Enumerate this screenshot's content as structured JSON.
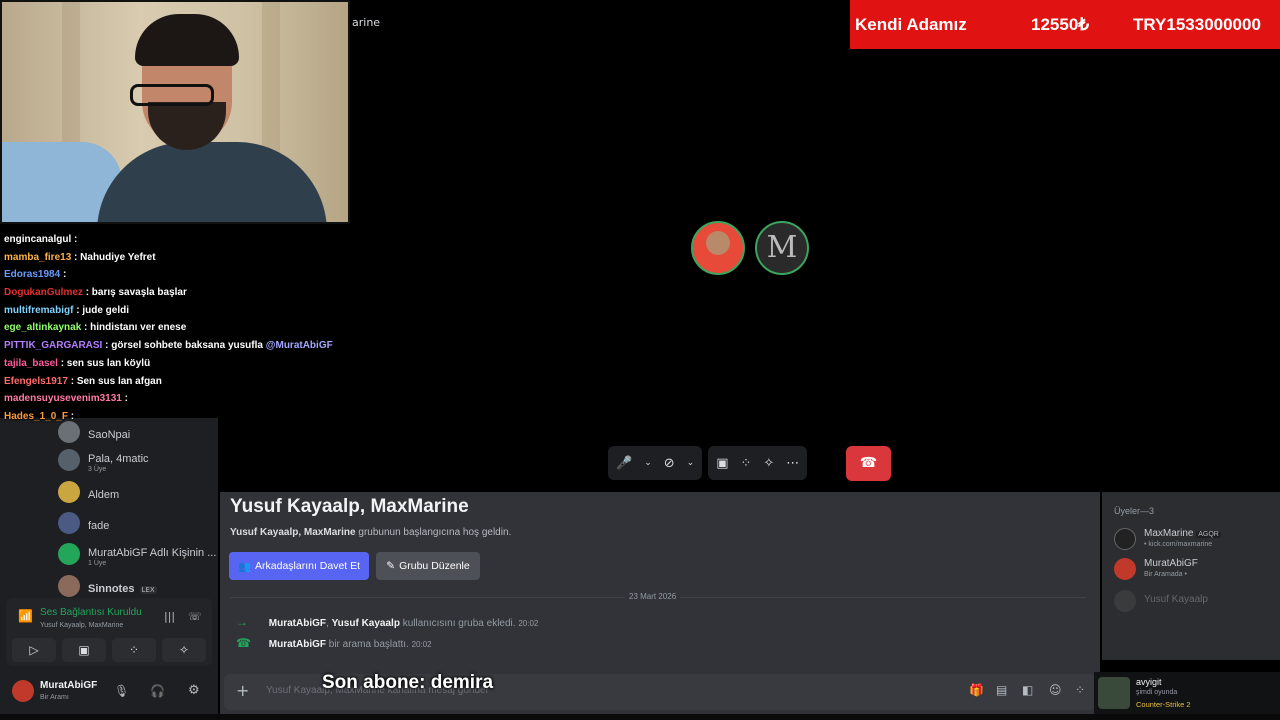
{
  "call": {
    "title_fragment": "arine",
    "participants": [
      "Yusuf Kayaalp",
      "MaxMarine"
    ]
  },
  "banner": {
    "label": "Kendi Adamız",
    "value1": "12550₺",
    "value2": "TRY1533000000"
  },
  "chat": [
    {
      "user": "engincanalgul",
      "msg": ":",
      "color": "#ffffff"
    },
    {
      "user": "mamba_fire13",
      "msg": ": Nahudiye Yefret",
      "color": "#ffb347"
    },
    {
      "user": "Edoras1984",
      "msg": ":",
      "color": "#6a9cff"
    },
    {
      "user": "DogukanGulmez",
      "msg": ": barış savaşla başlar",
      "color": "#e03030"
    },
    {
      "user": "multifremabigf",
      "msg": ": jude geldi",
      "color": "#7fd3ff"
    },
    {
      "user": "ege_altinkaynak",
      "msg": ": hindistanı ver enese",
      "color": "#8fff6a"
    },
    {
      "user": "PITTIK_GARGARASI",
      "msg": ": görsel sohbete baksana yusufla",
      "mention": "@MuratAbiGF",
      "color": "#b47dff"
    },
    {
      "user": "tajila_basel",
      "msg": ": sen sus lan köylü",
      "color": "#ff5a9c"
    },
    {
      "user": "Efengels1917",
      "msg": ": Sen sus lan afgan",
      "color": "#ff6b6b"
    },
    {
      "user": "madensuyusevenim3131",
      "msg": ":",
      "color": "#ff7aa8"
    },
    {
      "user": "Hades_1_0_F",
      "msg": ":",
      "color": "#ff9a3a"
    }
  ],
  "left_members": [
    {
      "name": "SaoNpai",
      "sub": ""
    },
    {
      "name": "Pala, 4matic",
      "sub": "3 Üye"
    },
    {
      "name": "Aldem",
      "sub": ""
    },
    {
      "name": "fade",
      "sub": ""
    },
    {
      "name": "MuratAbiGF Adlı Kişinin ...",
      "sub": "1 Üye"
    },
    {
      "name": "Sinnotes",
      "sub": "",
      "tag": "LEX"
    }
  ],
  "voice": {
    "status": "Ses Bağlantısı Kuruldu",
    "names": "Yusuf Kayaalp, MaxMarine"
  },
  "user": {
    "name": "MuratAbiGF",
    "status": "Bir Aramı"
  },
  "main": {
    "title": "Yusuf Kayaalp, MaxMarine",
    "welcome_bold": "Yusuf Kayaalp, MaxMarine",
    "welcome_rest": " grubunun başlangıcına hoş geldin.",
    "invite_label": "Arkadaşlarını Davet Et",
    "edit_label": "Grubu Düzenle",
    "date": "23 Mart 2026",
    "system": [
      {
        "icon": "→",
        "a": "MuratAbiGF",
        "mid": ", ",
        "b": "Yusuf Kayaalp",
        "text": " kullanıcısını gruba ekledi.",
        "time": "20:02"
      },
      {
        "icon": "☎",
        "a": "MuratAbiGF",
        "mid": "",
        "b": "",
        "text": " bir arama başlattı.",
        "time": "20:02"
      }
    ],
    "input_placeholder": "Yusuf Kayaalp, MaxMarine kanalına mesaj gönder"
  },
  "subscriber": "Son abone: demira",
  "members": {
    "title": "Üyeler—3",
    "list": [
      {
        "name": "MaxMarine",
        "tag": "AGQR",
        "sub": "• kick.com/maxmarine"
      },
      {
        "name": "MuratAbiGF",
        "tag": "",
        "sub": "Bir Aramada •"
      },
      {
        "name": "Yusuf Kayaalp",
        "tag": "",
        "sub": ""
      }
    ]
  },
  "activity": {
    "name": "avyigit",
    "label": "şimdi oyunda",
    "game": "Counter-Strike 2"
  }
}
